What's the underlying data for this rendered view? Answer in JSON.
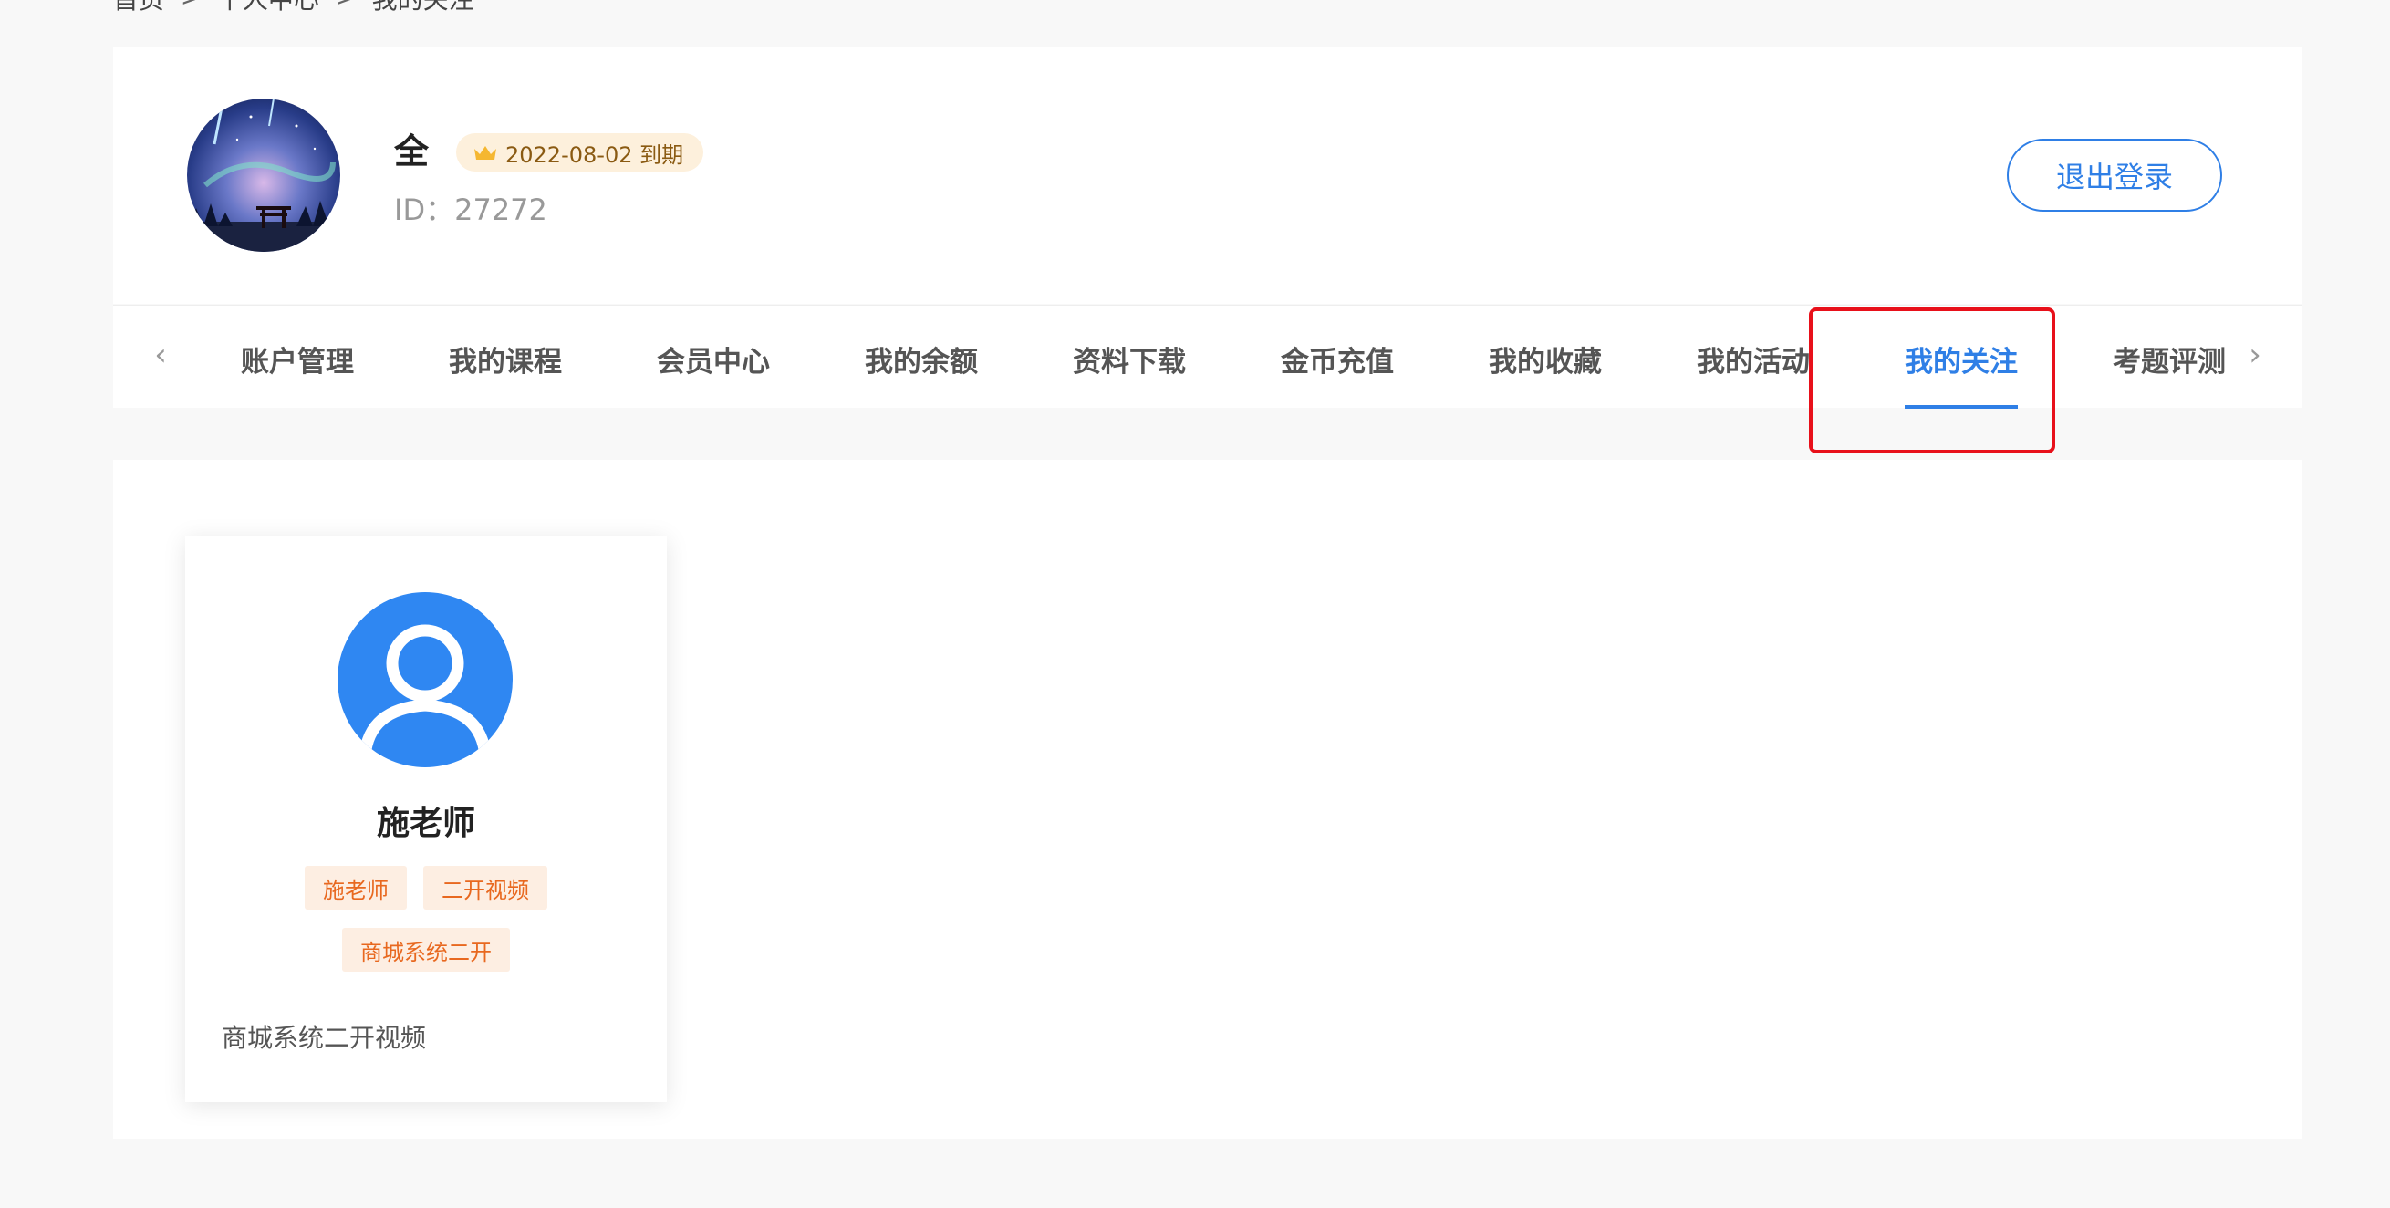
{
  "breadcrumb": {
    "items": [
      "首页",
      "个人中心",
      "我的关注"
    ],
    "separator": ">"
  },
  "profile": {
    "name": "全",
    "vip_text": "2022-08-02 到期",
    "id_label": "ID：",
    "id_value": "27272",
    "logout_label": "退出登录"
  },
  "tabs": {
    "items": [
      "账户管理",
      "我的课程",
      "会员中心",
      "我的余额",
      "资料下载",
      "金币充值",
      "我的收藏",
      "我的活动",
      "我的关注",
      "考题评测"
    ],
    "active": "我的关注",
    "prev_icon": "chevron-left-icon",
    "next_icon": "chevron-right-icon"
  },
  "teacher": {
    "name": "施老师",
    "tags": [
      "施老师",
      "二开视频",
      "商城系统二开"
    ],
    "description": "商城系统二开视频"
  },
  "colors": {
    "accent": "#2f7fe6",
    "highlight": "#e8101a",
    "tag_bg": "#fdeee2",
    "tag_text": "#e8681f",
    "vip_bg": "#fdf0dc"
  }
}
